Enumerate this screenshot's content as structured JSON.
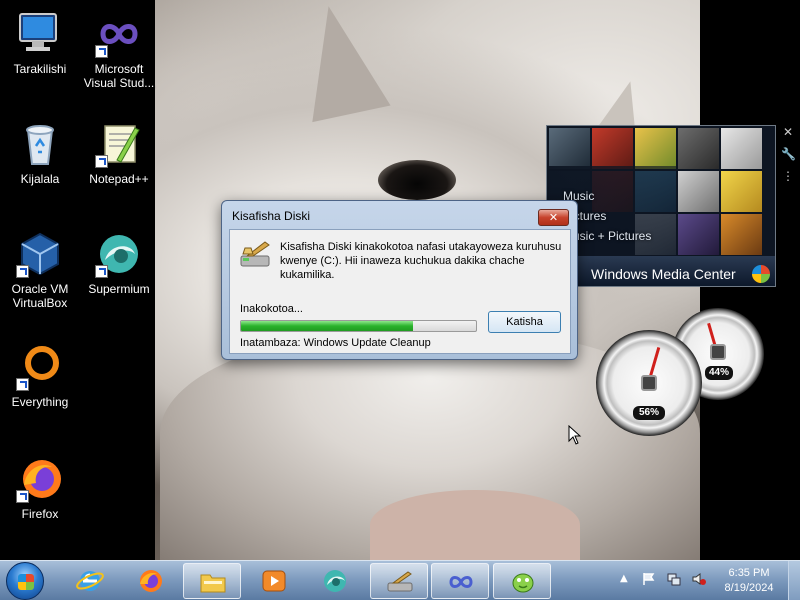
{
  "desktop_icons": [
    {
      "label": "Tarakilishi"
    },
    {
      "label": "Microsoft Visual Stud..."
    },
    {
      "label": "Kijalala"
    },
    {
      "label": "Notepad++"
    },
    {
      "label": "Oracle VM VirtualBox"
    },
    {
      "label": "Supermium"
    },
    {
      "label": "Everything"
    },
    {
      "label": "Firefox"
    }
  ],
  "media_center": {
    "menu": [
      "Music",
      "Pictures",
      "Music + Pictures"
    ],
    "brand": "Windows Media Center"
  },
  "cpu_meter": {
    "cpu_label": "56%",
    "cpu_value": 56,
    "memory_label": "44%",
    "memory_value": 44
  },
  "dialog": {
    "title": "Kisafisha Diski",
    "close": "✕",
    "message": "Kisafisha Diski kinakokotoa nafasi utakayoweza kuruhusu kwenye  (C:). Hii inaweza kuchukua dakika chache kukamilika.",
    "status": "Inakokotoa...",
    "progress_fraction": 0.73,
    "cancel_label": "Katisha",
    "currently_cleaning": "Inatambaza:  Windows Update Cleanup"
  },
  "taskbar": {
    "pinned": [
      "Internet Explorer",
      "Firefox",
      "Windows Explorer",
      "Windows Media Player",
      "Supermium",
      "Disk Cleanup",
      "Microsoft Visual Studio",
      "Notepad++"
    ],
    "clock_time": "6:35 PM",
    "clock_date": "8/19/2024"
  },
  "colors": {
    "taskbar": "#7f9cbf",
    "progress_green": "#29b22b",
    "close_red": "#c7432c"
  }
}
